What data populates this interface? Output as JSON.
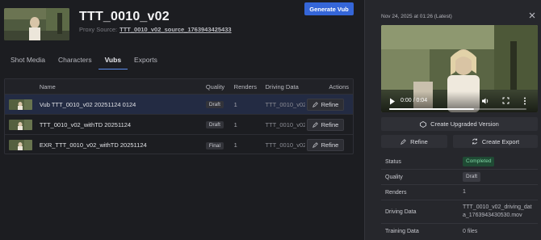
{
  "header": {
    "title": "TTT_0010_v02",
    "proxy_label": "Proxy Source:",
    "proxy_link": "TTT_0010_v02_source_1763943425433",
    "generate_button": "Generate Vub"
  },
  "tabs": [
    {
      "label": "Shot Media",
      "active": false
    },
    {
      "label": "Characters",
      "active": false
    },
    {
      "label": "Vubs",
      "active": true
    },
    {
      "label": "Exports",
      "active": false
    }
  ],
  "table": {
    "columns": {
      "name": "Name",
      "quality": "Quality",
      "renders": "Renders",
      "driving": "Driving Data",
      "actions": "Actions"
    },
    "rows": [
      {
        "name": "Vub TTT_0010_v02 20251124 0124",
        "quality": "Draft",
        "renders": "1",
        "driving": "TTT_0010_v02_driving_data",
        "action": "Refine",
        "selected": true
      },
      {
        "name": "TTT_0010_v02_withTD 20251124",
        "quality": "Draft",
        "renders": "1",
        "driving": "TTT_0010_v02_driving_data",
        "action": "Refine",
        "selected": false
      },
      {
        "name": "EXR_TTT_0010_v02_withTD 20251124",
        "quality": "Final",
        "renders": "1",
        "driving": "TTT_0010_v02_driving_data",
        "action": "Refine",
        "selected": false
      }
    ]
  },
  "detail": {
    "timestamp": "Nov 24, 2025 at 01:26 (Latest)",
    "video": {
      "time": "0:00 / 0:04",
      "progress": 0.62
    },
    "create_upgraded": "Create Upgraded Version",
    "refine": "Refine",
    "create_export": "Create Export",
    "properties": [
      {
        "key": "Status",
        "value": "Completed",
        "type": "status"
      },
      {
        "key": "Quality",
        "value": "Draft",
        "type": "badge"
      },
      {
        "key": "Renders",
        "value": "1",
        "type": "text"
      },
      {
        "key": "Driving Data",
        "value": "TTT_0010_v02_driving_data_1763943430530.mov",
        "type": "text"
      },
      {
        "key": "Training Data",
        "value": "0 files",
        "type": "text"
      }
    ]
  },
  "colors": {
    "accent": "#3566d8",
    "tab_underline": "#5c8ef0",
    "selected_row": "#232b43",
    "status_green": "#7fd4a3"
  }
}
